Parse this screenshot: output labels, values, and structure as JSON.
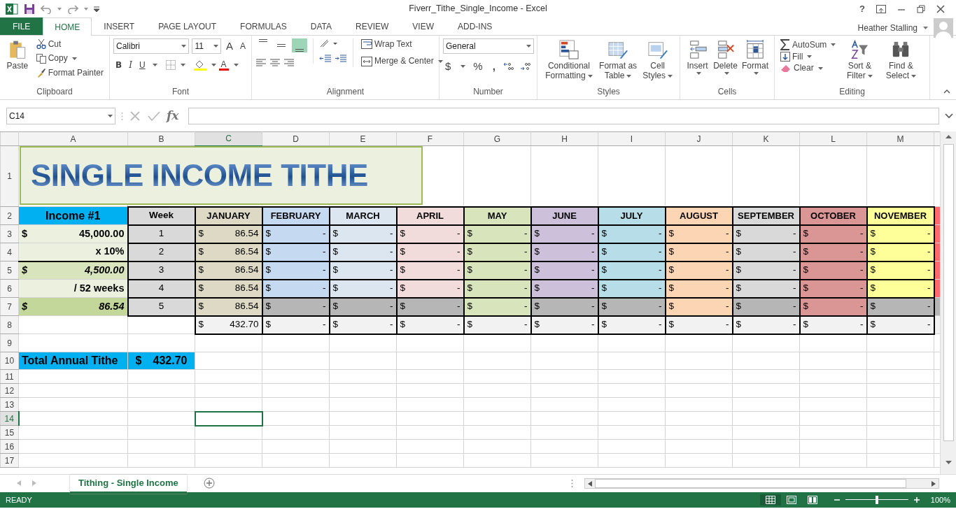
{
  "window": {
    "title": "Fiverr_Tithe_Single_Income - Excel",
    "help": "?"
  },
  "tabs": [
    {
      "label": "FILE",
      "kind": "file",
      "selected": false
    },
    {
      "label": "HOME",
      "kind": "tab",
      "selected": true
    },
    {
      "label": "INSERT",
      "kind": "tab",
      "selected": false
    },
    {
      "label": "PAGE LAYOUT",
      "kind": "tab",
      "selected": false
    },
    {
      "label": "FORMULAS",
      "kind": "tab",
      "selected": false
    },
    {
      "label": "DATA",
      "kind": "tab",
      "selected": false
    },
    {
      "label": "REVIEW",
      "kind": "tab",
      "selected": false
    },
    {
      "label": "VIEW",
      "kind": "tab",
      "selected": false
    },
    {
      "label": "ADD-INS",
      "kind": "tab",
      "selected": false
    }
  ],
  "user": {
    "name": "Heather Stalling"
  },
  "ribbon": {
    "clipboard": {
      "paste": "Paste",
      "cut": "Cut",
      "copy": "Copy",
      "format_painter": "Format Painter",
      "label": "Clipboard"
    },
    "font": {
      "name": "Calibri",
      "size": "11",
      "grow": "A",
      "shrink": "A",
      "bold": "B",
      "italic": "I",
      "underline": "U",
      "font_color": "A",
      "label": "Font"
    },
    "alignment": {
      "vertical": [
        {
          "selected": false
        },
        {
          "selected": false
        },
        {
          "selected": true
        }
      ],
      "wrap_text": "Wrap Text",
      "merge_center": "Merge & Center",
      "label": "Alignment"
    },
    "number": {
      "format": "General",
      "currency": "$",
      "percent": "%",
      "comma": ",",
      "label": "Number"
    },
    "styles": {
      "conditional": "Conditional Formatting",
      "format_table": "Format as Table",
      "cell_styles": "Cell Styles",
      "label": "Styles"
    },
    "cells": {
      "insert": "Insert",
      "delete": "Delete",
      "format": "Format",
      "label": "Cells"
    },
    "editing": {
      "autosum": "AutoSum",
      "fill": "Fill",
      "clear": "Clear",
      "sort_filter": "Sort & Filter",
      "find_select": "Find & Select",
      "label": "Editing"
    }
  },
  "formula_bar": {
    "name_box": "C14",
    "function_label": "fx"
  },
  "sheet": {
    "columns": [
      {
        "letter": "A",
        "selected": false
      },
      {
        "letter": "B",
        "selected": false
      },
      {
        "letter": "C",
        "selected": true
      },
      {
        "letter": "D",
        "selected": false
      },
      {
        "letter": "E",
        "selected": false
      },
      {
        "letter": "F",
        "selected": false
      },
      {
        "letter": "G",
        "selected": false
      },
      {
        "letter": "H",
        "selected": false
      },
      {
        "letter": "I",
        "selected": false
      },
      {
        "letter": "J",
        "selected": false
      },
      {
        "letter": "K",
        "selected": false
      },
      {
        "letter": "L",
        "selected": false
      },
      {
        "letter": "M",
        "selected": false
      }
    ],
    "rows": [
      {
        "number": "1",
        "selected": false
      },
      {
        "number": "2",
        "selected": false
      },
      {
        "number": "3",
        "selected": false
      },
      {
        "number": "4",
        "selected": false
      },
      {
        "number": "5",
        "selected": false
      },
      {
        "number": "6",
        "selected": false
      },
      {
        "number": "7",
        "selected": false
      },
      {
        "number": "8",
        "selected": false
      },
      {
        "number": "9",
        "selected": false
      },
      {
        "number": "10",
        "selected": false
      },
      {
        "number": "11",
        "selected": false
      },
      {
        "number": "12",
        "selected": false
      },
      {
        "number": "13",
        "selected": false
      },
      {
        "number": "14",
        "selected": true
      },
      {
        "number": "15",
        "selected": false
      },
      {
        "number": "16",
        "selected": false
      },
      {
        "number": "17",
        "selected": false
      }
    ],
    "banner": {
      "text": "SINGLE INCOME TITHE"
    },
    "income_header": "Income #1",
    "income_lines": [
      {
        "kind": "amount",
        "symbol": "$",
        "value": "45,000.00"
      },
      {
        "kind": "rate",
        "value": "x 10%"
      },
      {
        "kind": "tithe",
        "symbol": "$",
        "value": "4,500.00"
      },
      {
        "kind": "divisor",
        "value": "/ 52 weeks"
      },
      {
        "kind": "weekly",
        "symbol": "$",
        "value": "86.54"
      }
    ],
    "week_header": "Week",
    "weeks": [
      "1",
      "2",
      "3",
      "4",
      "5"
    ],
    "months": [
      {
        "kind": "month",
        "name": "JANUARY",
        "color": "#ddd9c4",
        "weeks": [
          {
            "symbol": "$",
            "amount": "86.54",
            "in_month": true
          },
          {
            "symbol": "$",
            "amount": "86.54",
            "in_month": true
          },
          {
            "symbol": "$",
            "amount": "86.54",
            "in_month": true
          },
          {
            "symbol": "$",
            "amount": "86.54",
            "in_month": true
          },
          {
            "symbol": "$",
            "amount": "86.54",
            "in_month": true
          }
        ],
        "total": {
          "symbol": "$",
          "amount": "432.70"
        }
      },
      {
        "kind": "month",
        "name": "FEBRUARY",
        "color": "#c5d9f1",
        "weeks": [
          {
            "symbol": "$",
            "amount": "-",
            "in_month": true
          },
          {
            "symbol": "$",
            "amount": "-",
            "in_month": true
          },
          {
            "symbol": "$",
            "amount": "-",
            "in_month": true
          },
          {
            "symbol": "$",
            "amount": "-",
            "in_month": true
          },
          {
            "symbol": "$",
            "amount": "-",
            "in_month": false
          }
        ],
        "total": {
          "symbol": "$",
          "amount": "-"
        }
      },
      {
        "kind": "month",
        "name": "MARCH",
        "color": "#dce6f1",
        "weeks": [
          {
            "symbol": "$",
            "amount": "-",
            "in_month": true
          },
          {
            "symbol": "$",
            "amount": "-",
            "in_month": true
          },
          {
            "symbol": "$",
            "amount": "-",
            "in_month": true
          },
          {
            "symbol": "$",
            "amount": "-",
            "in_month": true
          },
          {
            "symbol": "$",
            "amount": "-",
            "in_month": false
          }
        ],
        "total": {
          "symbol": "$",
          "amount": "-"
        }
      },
      {
        "kind": "month",
        "name": "APRIL",
        "color": "#f2dcdb",
        "weeks": [
          {
            "symbol": "$",
            "amount": "-",
            "in_month": true
          },
          {
            "symbol": "$",
            "amount": "-",
            "in_month": true
          },
          {
            "symbol": "$",
            "amount": "-",
            "in_month": true
          },
          {
            "symbol": "$",
            "amount": "-",
            "in_month": true
          },
          {
            "symbol": "$",
            "amount": "-",
            "in_month": false
          }
        ],
        "total": {
          "symbol": "$",
          "amount": "-"
        }
      },
      {
        "kind": "month",
        "name": "MAY",
        "color": "#d8e4bc",
        "weeks": [
          {
            "symbol": "$",
            "amount": "-",
            "in_month": true
          },
          {
            "symbol": "$",
            "amount": "-",
            "in_month": true
          },
          {
            "symbol": "$",
            "amount": "-",
            "in_month": true
          },
          {
            "symbol": "$",
            "amount": "-",
            "in_month": true
          },
          {
            "symbol": "$",
            "amount": "-",
            "in_month": true
          }
        ],
        "total": {
          "symbol": "$",
          "amount": "-"
        }
      },
      {
        "kind": "month",
        "name": "JUNE",
        "color": "#ccc0da",
        "weeks": [
          {
            "symbol": "$",
            "amount": "-",
            "in_month": true
          },
          {
            "symbol": "$",
            "amount": "-",
            "in_month": true
          },
          {
            "symbol": "$",
            "amount": "-",
            "in_month": true
          },
          {
            "symbol": "$",
            "amount": "-",
            "in_month": true
          },
          {
            "symbol": "$",
            "amount": "-",
            "in_month": false
          }
        ],
        "total": {
          "symbol": "$",
          "amount": "-"
        }
      },
      {
        "kind": "month",
        "name": "JULY",
        "color": "#b7dee8",
        "weeks": [
          {
            "symbol": "$",
            "amount": "-",
            "in_month": true
          },
          {
            "symbol": "$",
            "amount": "-",
            "in_month": true
          },
          {
            "symbol": "$",
            "amount": "-",
            "in_month": true
          },
          {
            "symbol": "$",
            "amount": "-",
            "in_month": true
          },
          {
            "symbol": "$",
            "amount": "-",
            "in_month": false
          }
        ],
        "total": {
          "symbol": "$",
          "amount": "-"
        }
      },
      {
        "kind": "month",
        "name": "AUGUST",
        "color": "#fcd5b4",
        "weeks": [
          {
            "symbol": "$",
            "amount": "-",
            "in_month": true
          },
          {
            "symbol": "$",
            "amount": "-",
            "in_month": true
          },
          {
            "symbol": "$",
            "amount": "-",
            "in_month": true
          },
          {
            "symbol": "$",
            "amount": "-",
            "in_month": true
          },
          {
            "symbol": "$",
            "amount": "-",
            "in_month": true
          }
        ],
        "total": {
          "symbol": "$",
          "amount": "-"
        }
      },
      {
        "kind": "month",
        "name": "SEPTEMBER",
        "color": "#d9d9d9",
        "weeks": [
          {
            "symbol": "$",
            "amount": "-",
            "in_month": true
          },
          {
            "symbol": "$",
            "amount": "-",
            "in_month": true
          },
          {
            "symbol": "$",
            "amount": "-",
            "in_month": true
          },
          {
            "symbol": "$",
            "amount": "-",
            "in_month": true
          },
          {
            "symbol": "$",
            "amount": "-",
            "in_month": false
          }
        ],
        "total": {
          "symbol": "$",
          "amount": "-"
        }
      },
      {
        "kind": "month",
        "name": "OCTOBER",
        "color": "#da9694",
        "weeks": [
          {
            "symbol": "$",
            "amount": "-",
            "in_month": true
          },
          {
            "symbol": "$",
            "amount": "-",
            "in_month": true
          },
          {
            "symbol": "$",
            "amount": "-",
            "in_month": true
          },
          {
            "symbol": "$",
            "amount": "-",
            "in_month": true
          },
          {
            "symbol": "$",
            "amount": "-",
            "in_month": true
          }
        ],
        "total": {
          "symbol": "$",
          "amount": "-"
        }
      },
      {
        "kind": "month",
        "name": "NOVEMBER",
        "color": "#ffff99",
        "weeks": [
          {
            "symbol": "$",
            "amount": "-",
            "in_month": true
          },
          {
            "symbol": "$",
            "amount": "-",
            "in_month": true
          },
          {
            "symbol": "$",
            "amount": "-",
            "in_month": true
          },
          {
            "symbol": "$",
            "amount": "-",
            "in_month": true
          },
          {
            "symbol": "$",
            "amount": "-",
            "in_month": false
          }
        ],
        "total": {
          "symbol": "$",
          "amount": "-"
        }
      },
      {
        "kind": "cut",
        "color": "#ff6b6b"
      }
    ],
    "total": {
      "label": "Total Annual Tithe",
      "symbol": "$",
      "amount": "432.70"
    }
  },
  "sheet_tabs": [
    {
      "label": "Tithing - Single Income",
      "selected": true
    }
  ],
  "status_bar": {
    "status": "READY",
    "views": [
      {
        "selected": true
      },
      {
        "selected": false
      },
      {
        "selected": false
      }
    ],
    "zoom": {
      "level": 0.5
    },
    "zoom_label": "100%"
  }
}
